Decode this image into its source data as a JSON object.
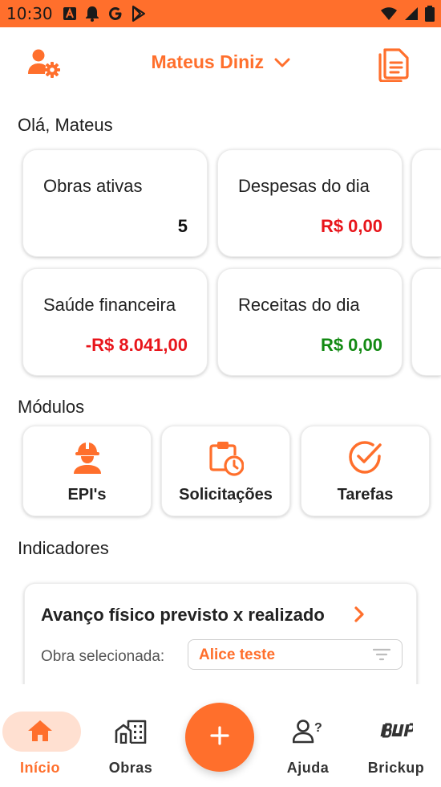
{
  "status_bar": {
    "time": "10:30",
    "icons": [
      "translate-icon",
      "notification-bell-icon",
      "google-icon",
      "play-store-icon",
      "wifi-icon",
      "signal-icon",
      "battery-icon"
    ]
  },
  "header": {
    "user_name": "Mateus Diniz",
    "icons": [
      "user-settings-icon",
      "chevron-down-icon",
      "report-icon"
    ]
  },
  "greeting": "Olá, Mateus",
  "summary_cards": [
    {
      "label": "Obras ativas",
      "value": "5",
      "value_color": "#111111"
    },
    {
      "label": "Despesas do dia",
      "value": "R$ 0,00",
      "value_color": "#e8151b"
    },
    {
      "label": "Saúde financeira",
      "value": "-R$ 8.041,00",
      "value_color": "#e8151b"
    },
    {
      "label": "Receitas do dia",
      "value": "R$ 0,00",
      "value_color": "#138a13"
    }
  ],
  "modules": {
    "title": "Módulos",
    "items": [
      {
        "label": "EPI's",
        "icon": "worker-helmet-icon"
      },
      {
        "label": "Solicitações",
        "icon": "clipboard-clock-icon"
      },
      {
        "label": "Tarefas",
        "icon": "check-circle-icon"
      }
    ]
  },
  "indicators": {
    "title": "Indicadores",
    "card_title": "Avanço físico previsto x realizado",
    "obra_label": "Obra selecionada:",
    "obra_value": "Alice teste"
  },
  "bottom_nav": {
    "items": [
      {
        "label": "Início",
        "icon": "home-icon",
        "active": true
      },
      {
        "label": "Obras",
        "icon": "buildings-icon",
        "active": false
      },
      {
        "label": "Ajuda",
        "icon": "help-user-icon",
        "active": false
      },
      {
        "label": "Brickup",
        "icon": "brickup-logo-icon",
        "active": false
      }
    ],
    "fab_icon": "plus-icon"
  },
  "colors": {
    "accent": "#ff6f2c",
    "negative": "#e8151b",
    "positive": "#138a13",
    "active_pill": "#ffe0d1"
  }
}
